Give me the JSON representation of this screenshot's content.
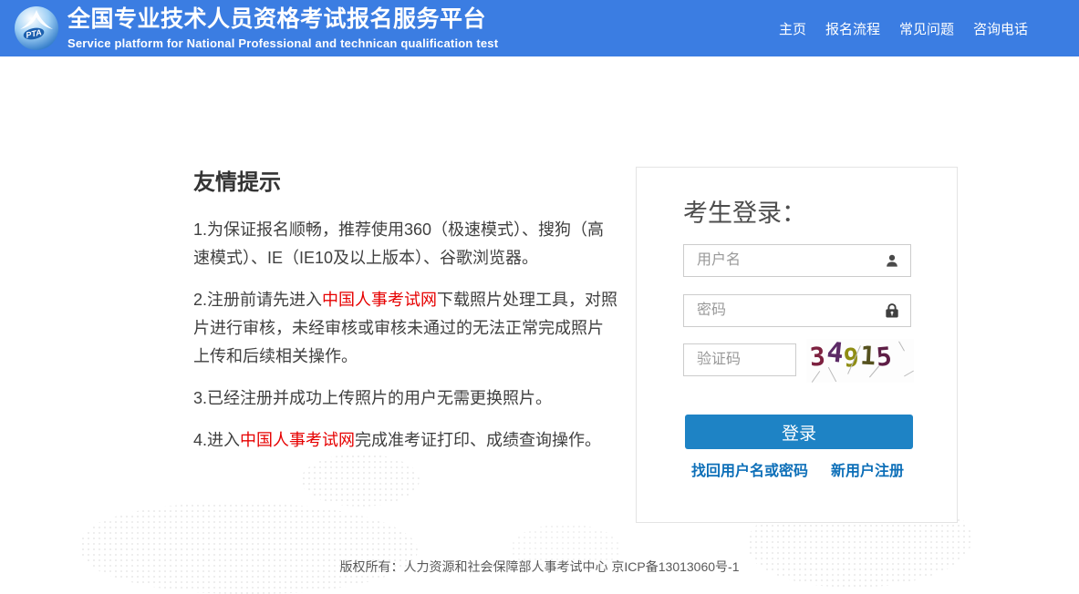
{
  "header": {
    "logo_text": "PTA",
    "title": "全国专业技术人员资格考试报名服务平台",
    "subtitle": "Service platform for National Professional and technican qualification test",
    "nav": [
      {
        "label": "主页"
      },
      {
        "label": "报名流程"
      },
      {
        "label": "常见问题"
      },
      {
        "label": "咨询电话"
      }
    ]
  },
  "tips": {
    "heading": "友情提示",
    "items": [
      {
        "pre": "1.为保证报名顺畅，推荐使用360（极速模式）、搜狗（高速模式）、IE（IE10及以上版本）、谷歌浏览器。",
        "link": "",
        "post": ""
      },
      {
        "pre": "2.注册前请先进入",
        "link": "中国人事考试网",
        "post": "下载照片处理工具，对照片进行审核，未经审核或审核未通过的无法正常完成照片上传和后续相关操作。"
      },
      {
        "pre": "3.已经注册并成功上传照片的用户无需更换照片。",
        "link": "",
        "post": ""
      },
      {
        "pre": "4.进入",
        "link": "中国人事考试网",
        "post": "完成准考证打印、成绩查询操作。"
      }
    ]
  },
  "login": {
    "title": "考生登录：",
    "username": {
      "placeholder": "用户名",
      "value": ""
    },
    "password": {
      "placeholder": "密码",
      "value": ""
    },
    "captcha": {
      "placeholder": "验证码",
      "value": "",
      "code": "34915",
      "digits": [
        {
          "char": "3",
          "color": "#7d2140"
        },
        {
          "char": "4",
          "color": "#5c2a66"
        },
        {
          "char": "9",
          "color": "#8f8d13"
        },
        {
          "char": "1",
          "color": "#55511e"
        },
        {
          "char": "5",
          "color": "#5e1e46"
        }
      ]
    },
    "login_button": "登录",
    "links": [
      {
        "label": "找回用户名或密码"
      },
      {
        "label": "新用户注册"
      }
    ]
  },
  "footer": {
    "copyright": "版权所有：人力资源和社会保障部人事考试中心 京ICP备13013060号-1"
  },
  "colors": {
    "header_bg": "#3b7de2",
    "button_bg": "#1e83c5",
    "link_blue": "#0d6fb8",
    "highlight_red": "#e60000"
  }
}
